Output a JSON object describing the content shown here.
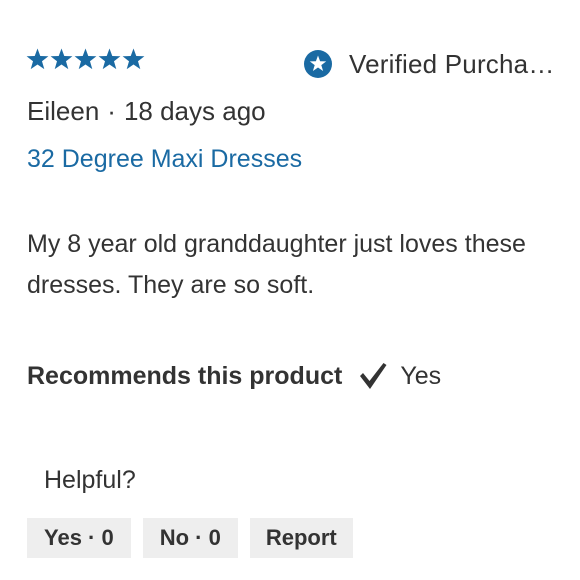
{
  "rating": {
    "value": 5,
    "max": 5,
    "star_color": "#1a6aa3"
  },
  "verified": {
    "label": "Verified Purcha…",
    "icon": "verified-star-badge-icon",
    "icon_color": "#1a6aa3"
  },
  "byline": {
    "author": "Eileen",
    "separator": "·",
    "time": "18 days ago"
  },
  "product": {
    "name": "32 Degree Maxi Dresses",
    "link_color": "#1a6aa3"
  },
  "review": {
    "text": "My 8 year old granddaughter just loves these dresses. They are so soft."
  },
  "recommendation": {
    "label": "Recommends this product",
    "icon": "checkmark-icon",
    "value": "Yes"
  },
  "helpful": {
    "label": "Helpful?",
    "yes_button": "Yes · 0",
    "no_button": "No · 0",
    "report_button": "Report"
  }
}
